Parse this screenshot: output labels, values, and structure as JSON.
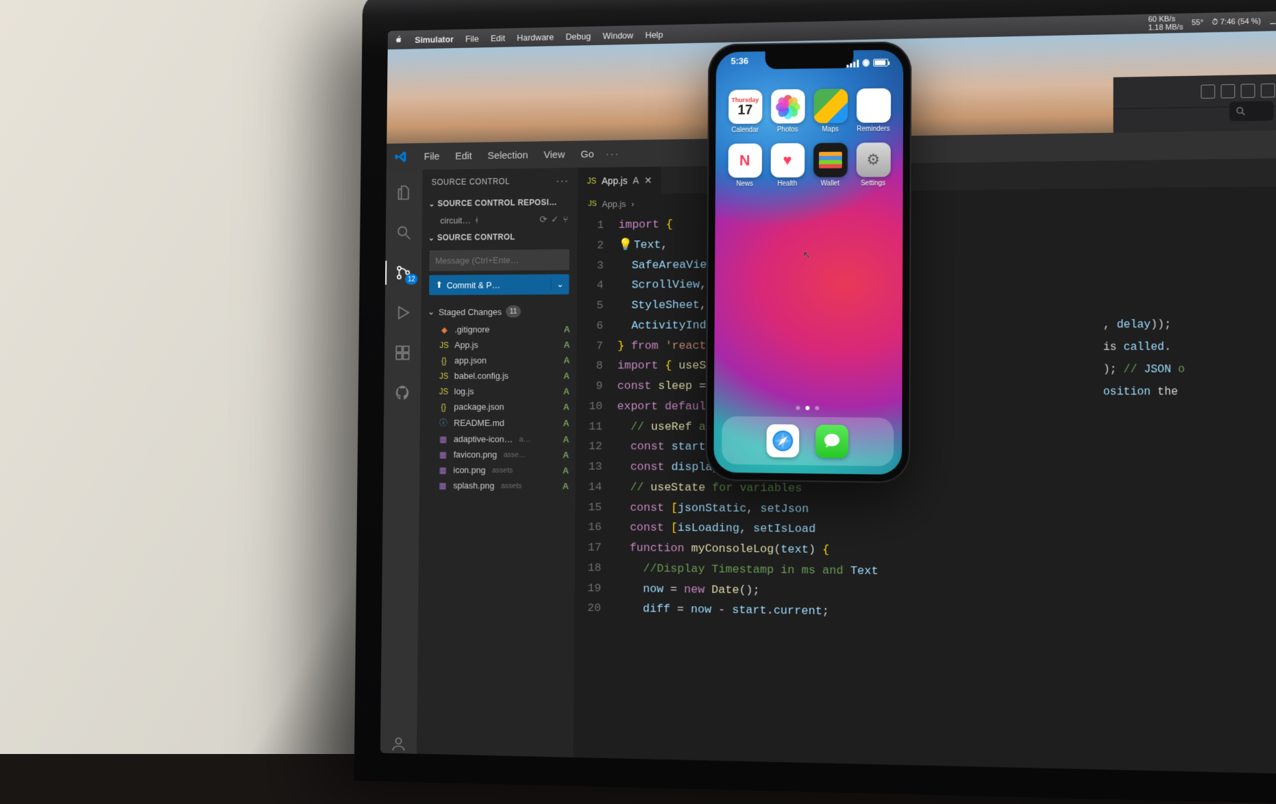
{
  "mac_menubar": {
    "app": "Simulator",
    "items": [
      "File",
      "Edit",
      "Hardware",
      "Debug",
      "Window",
      "Help"
    ],
    "status": {
      "time": "7:46",
      "battery_pct": "54 %",
      "net_down": "60 KB/s",
      "net_up": "1.18 MB/s",
      "temp": "55°"
    }
  },
  "vscode": {
    "menu": [
      "File",
      "Edit",
      "Selection",
      "View",
      "Go"
    ],
    "sidebar": {
      "title": "SOURCE CONTROL",
      "sections": {
        "repos_header": "SOURCE CONTROL REPOSI…",
        "repo_name": "circuit…",
        "control_header": "SOURCE CONTROL"
      },
      "commit_placeholder": "Message (Ctrl+Ente…",
      "commit_button": "Commit & P…",
      "staged_header": "Staged Changes",
      "staged_count": "11",
      "files": [
        {
          "icon": "git",
          "name": ".gitignore",
          "sub": "",
          "status": "A"
        },
        {
          "icon": "js",
          "name": "App.js",
          "sub": "",
          "status": "A"
        },
        {
          "icon": "json",
          "name": "app.json",
          "sub": "",
          "status": "A"
        },
        {
          "icon": "js",
          "name": "babel.config.js",
          "sub": "",
          "status": "A"
        },
        {
          "icon": "js",
          "name": "log.js",
          "sub": "",
          "status": "A"
        },
        {
          "icon": "json",
          "name": "package.json",
          "sub": "",
          "status": "A"
        },
        {
          "icon": "md",
          "name": "README.md",
          "sub": "",
          "status": "A"
        },
        {
          "icon": "img",
          "name": "adaptive-icon…",
          "sub": "a…",
          "status": "A"
        },
        {
          "icon": "img",
          "name": "favicon.png",
          "sub": "asse…",
          "status": "A"
        },
        {
          "icon": "img",
          "name": "icon.png",
          "sub": "assets",
          "status": "A"
        },
        {
          "icon": "img",
          "name": "splash.png",
          "sub": "assets",
          "status": "A"
        }
      ],
      "scm_badge": "12"
    },
    "editor": {
      "tab": {
        "name": "App.js",
        "modified": "A"
      },
      "breadcrumb": "App.js",
      "lines": [
        "import {",
        "  Text,",
        "  SafeAreaView,",
        "  ScrollView,",
        "  StyleSheet,",
        "  ActivityIndicator,",
        "} from 'react-native';",
        "import { useState, useRef, use",
        "const sleep = (delay) => new",
        "export default function App()",
        "  // useRef are for variable",
        "  const start = useRef(null);",
        "  const displayLog = useRef(",
        "  // useState for variables",
        "  const [jsonStatic, setJson",
        "  const [isLoading, setIsLoad",
        "  function myConsoleLog(text) {",
        "    //Display Timestamp in ms and Text",
        "    now = new Date();",
        "    diff = now - start.current;"
      ]
    }
  },
  "right_code": [
    ", delay));",
    "",
    "is called.",
    "",
    "",
    "); // JSON o",
    "osition the"
  ],
  "iphone": {
    "time": "5:36",
    "apps_row1": [
      {
        "id": "calendar",
        "label": "Calendar",
        "day_name": "Thursday",
        "day_num": "17"
      },
      {
        "id": "photos",
        "label": "Photos"
      },
      {
        "id": "maps",
        "label": "Maps"
      },
      {
        "id": "reminders",
        "label": "Reminders"
      }
    ],
    "apps_row2": [
      {
        "id": "news",
        "label": "News"
      },
      {
        "id": "health",
        "label": "Health"
      },
      {
        "id": "wallet",
        "label": "Wallet"
      },
      {
        "id": "settings",
        "label": "Settings"
      }
    ],
    "dock": [
      "safari",
      "messages"
    ]
  }
}
